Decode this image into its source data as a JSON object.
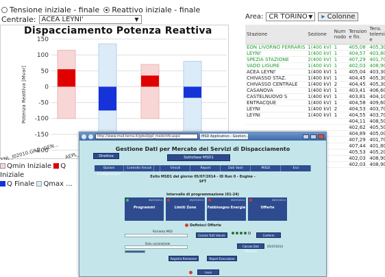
{
  "controls": {
    "radio_tensione": "Tensione iniziale - finale",
    "radio_reattivo": "Reattivo iniziale - finale",
    "centrale_label": "Centrale:",
    "centrale_value": "ACEA LEYNI'",
    "area_label": "Area:",
    "area_value": "CR TORINO",
    "colonne_button": "Colonne"
  },
  "chart_data": {
    "type": "bar",
    "title": "Dispacciamento Potenza Reattiva",
    "ylabel": "Potenza Reattiva [Mvar]",
    "ylim": [
      -200,
      150
    ],
    "yticks": [
      "150",
      "100",
      "50",
      "0",
      "-50",
      "-100",
      "-150",
      "-200"
    ],
    "categories": [
      "GENL_I02010.GRA...GEN...",
      "AEPL_I02010...",
      "",
      ""
    ],
    "series": [
      {
        "name": "Qmin Iniziale",
        "color": "#f8d6d6",
        "values": [
          -100,
          -100,
          -100,
          -100
        ]
      },
      {
        "name": "Q Iniziale",
        "color": "#e00000",
        "values": [
          55,
          0,
          35,
          0
        ]
      },
      {
        "name": "Qmax Iniziale",
        "color": "#f8d6d6",
        "values": [
          115,
          0,
          70,
          0
        ]
      },
      {
        "name": "Q Finale",
        "color": "#1533d8",
        "values": [
          0,
          -75,
          0,
          -35
        ]
      },
      {
        "name": "Qmin Finale",
        "color": "#dcebf8",
        "values": [
          0,
          -170,
          0,
          -150
        ]
      },
      {
        "name": "Qmax Finale",
        "color": "#dcebf8",
        "values": [
          0,
          135,
          0,
          80
        ]
      }
    ],
    "legend": [
      "Qmin Iniziale",
      "Q Iniziale",
      "Q Finale",
      "Qmax ..."
    ]
  },
  "table": {
    "headers": [
      "Stazione",
      "Sezione",
      "Num nodo",
      "Tension e fin.",
      "Tens. telemisur e"
    ],
    "rows": [
      {
        "color": "g",
        "cells": [
          "EON LIVORNO FERRARIS",
          "1(400 kV)",
          "1",
          "405,08",
          "405,30"
        ]
      },
      {
        "color": "g",
        "cells": [
          "LEYNI'",
          "1(400 kV)",
          "1",
          "404,57",
          "403,80"
        ]
      },
      {
        "color": "g",
        "cells": [
          "SPEZIA STAZIONE",
          "2(400 kV)",
          "1",
          "407,29",
          "401,70"
        ]
      },
      {
        "color": "g",
        "cells": [
          "VADO LIGURE",
          "1(400 kV)",
          "1",
          "402,03",
          "408,90"
        ]
      },
      {
        "color": "k",
        "cells": [
          "ACEA LEYNI'",
          "1(400 kV)",
          "1",
          "405,04",
          "403,30"
        ]
      },
      {
        "color": "k",
        "cells": [
          "CHIVASSO STAZ.",
          "1(400 kV)",
          "1",
          "404,45",
          "405,30"
        ]
      },
      {
        "color": "k",
        "cells": [
          "CHIVASSO CENTRALE",
          "1(400 kV)",
          "2",
          "404,45",
          "405,30"
        ]
      },
      {
        "color": "k",
        "cells": [
          "CASANOVA",
          "1(400 kV)",
          "1",
          "403,41",
          "406,60"
        ]
      },
      {
        "color": "k",
        "cells": [
          "CASTELNUOVO S",
          "1(400 kV)",
          "1",
          "403,81",
          "404,10"
        ]
      },
      {
        "color": "k",
        "cells": [
          "ENTRACQUE",
          "1(400 kV)",
          "1",
          "404,58",
          "409,60"
        ]
      },
      {
        "color": "k",
        "cells": [
          "LEYNI",
          "1(400 kV)",
          "2",
          "404,53",
          "403,70"
        ]
      },
      {
        "color": "k",
        "cells": [
          "LEYNI",
          "1(400 kV)",
          "1",
          "404,55",
          "403,70"
        ]
      },
      {
        "color": "k",
        "cells": [
          "",
          "",
          "",
          "404,11",
          "408,50"
        ]
      },
      {
        "color": "k",
        "cells": [
          "",
          "",
          "",
          "402,62",
          "405,50"
        ]
      },
      {
        "color": "k",
        "cells": [
          "",
          "",
          "",
          "404,89",
          "405,00"
        ]
      },
      {
        "color": "k",
        "cells": [
          "",
          "",
          "",
          "407,29",
          "401,70"
        ]
      },
      {
        "color": "k",
        "cells": [
          "",
          "",
          "",
          "407,44",
          "401,80"
        ]
      },
      {
        "color": "k",
        "cells": [
          "",
          "",
          "",
          "405,53",
          "405,20"
        ]
      },
      {
        "color": "k",
        "cells": [
          "",
          "",
          "",
          "402,03",
          "408,90"
        ]
      },
      {
        "color": "k",
        "cells": [
          "",
          "",
          "",
          "402,03",
          "408,90"
        ]
      }
    ]
  },
  "browser": {
    "url": "http://www.msd.terna.it/gdsd/ppl_msdcinfo.aspx",
    "tab": "MSD Applicativo - Gestion...",
    "app_title": "Gestione Dati per Mercato dei Servizi di Dispacciamento",
    "left_button": "Direttive",
    "main_button": "Sottofase MSD1",
    "nav": [
      "Opzioni Configurazione",
      "Controllo Vincoli",
      "",
      "Vincoli",
      "Report",
      "Dati Vaoli",
      "MSD2",
      "Esci"
    ],
    "esito": "Esito MSD1 del giorno 05/07/2014 - ID Run 0 - Engine -",
    "esito_2": "SFT",
    "interval": "Intervallo di programmazione (01-24)",
    "tiles": [
      {
        "label": "Programmi",
        "date": "05/07/2014",
        "dot": "#35d43a"
      },
      {
        "label": "Limiti Zone",
        "date": "05/07/2014",
        "dot": "#d63a2a"
      },
      {
        "label": "Fabbisogno Energia",
        "date": "05/07/2014",
        "dot": "#d63a2a"
      },
      {
        "label": "Offerte",
        "date": "05/07/2014",
        "dot": "#d63a2a"
      }
    ],
    "definisci": "Definisci Offerte",
    "form_label_1": "Richiesta MSD",
    "form_label_2": "Dato calcolati/ode",
    "form_btn_1": "Calcola Tutti Volumi",
    "form_btn_2": "Conferm",
    "form_btn_3": "Calcola Dati Rilevanti",
    "form_value": "05/07/2014",
    "btn_registra": "Registra Riemanne",
    "btn_report": "Report Esecuzione",
    "btn_invio": "Invio"
  }
}
